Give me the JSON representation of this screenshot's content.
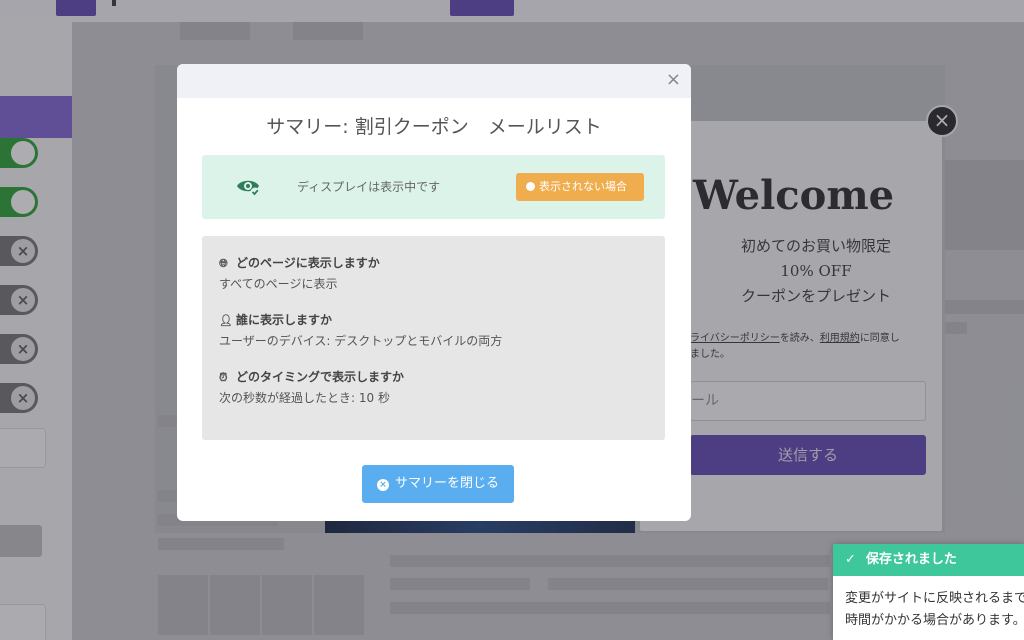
{
  "colors": {
    "accent": "#5b3fae",
    "toggle_on": "#1f9d2a",
    "status_bg": "#dcf3ea",
    "warning": "#f0ad4e",
    "primary_button": "#5aaef0",
    "toast_header": "#3ec79a"
  },
  "background_popup": {
    "heading": "Welcome",
    "offer_lines": [
      "初めてのお買い物限定",
      "10% OFF",
      "クーポンをプレゼント"
    ],
    "consent": {
      "privacy_link": "ライバシーポリシー",
      "text_mid": "を読み、",
      "terms_link": "利用規約",
      "text_end": "に同意し",
      "text_line2": "ました。"
    },
    "email_placeholder": "ール",
    "submit_label": "送信する",
    "close_glyph": "×"
  },
  "modal": {
    "close_glyph": "×",
    "title": "サマリー: 割引クーポン　メールリスト",
    "status_text": "ディスプレイは表示中です",
    "warning_button": "表示されない場合",
    "sections": [
      {
        "icon": "globe-icon",
        "heading": "どのページに表示しますか",
        "value": "すべてのページに表示"
      },
      {
        "icon": "user-icon",
        "heading": "誰に表示しますか",
        "value": "ユーザーのデバイス: デスクトップとモバイルの両方"
      },
      {
        "icon": "alarm-clock-icon",
        "heading": "どのタイミングで表示しますか",
        "value": "次の秒数が経過したとき: 10 秒"
      }
    ],
    "close_summary_button": "サマリーを閉じる"
  },
  "toast": {
    "title": "保存されました",
    "message": "変更がサイトに反映されるまでに時間がかかる場合があります。"
  }
}
